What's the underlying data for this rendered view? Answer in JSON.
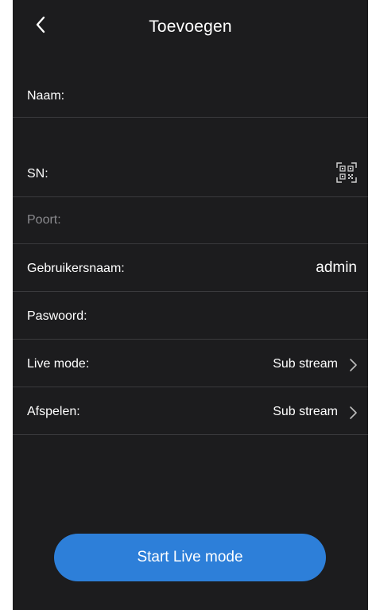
{
  "header": {
    "title": "Toevoegen",
    "back_icon": "chevron-left-icon"
  },
  "form": {
    "name_label": "Naam:",
    "sn_label": "SN:",
    "qr_icon": "qr-scan-icon",
    "port_label": "Poort:",
    "username_label": "Gebruikersnaam:",
    "username_value": "admin",
    "password_label": "Paswoord:",
    "live_mode_label": "Live mode:",
    "live_mode_value": "Sub stream",
    "playback_label": "Afspelen:",
    "playback_value": "Sub stream"
  },
  "actions": {
    "start_label": "Start Live mode"
  },
  "colors": {
    "background": "#1c1c1e",
    "divider": "#3a3a3d",
    "accent": "#2d7fd9",
    "muted_text": "#8a8a8e"
  }
}
